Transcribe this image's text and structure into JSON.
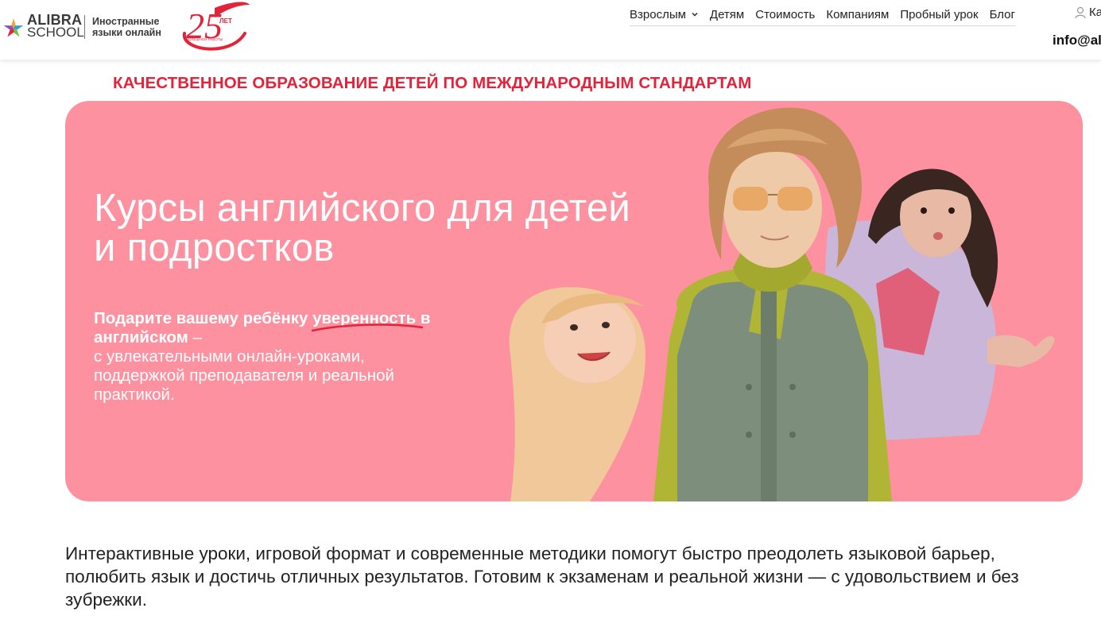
{
  "header": {
    "logo": {
      "name": "ALIBRA",
      "school": "SCHOOL"
    },
    "tagline": "Иностранные языки онлайн",
    "anniversary": {
      "number": "25",
      "label": "ЛЕТ",
      "caption": "УСПЕШНОЙ РАБОТЫ"
    },
    "nav": [
      {
        "label": "Взрослым",
        "has_dropdown": true
      },
      {
        "label": "Детям"
      },
      {
        "label": "Стоимость"
      },
      {
        "label": "Компаниям"
      },
      {
        "label": "Пробный урок"
      },
      {
        "label": "Блог"
      }
    ],
    "account_label": "Ка",
    "email": "info@al"
  },
  "eyebrow": "КАЧЕСТВЕННОЕ ОБРАЗОВАНИЕ ДЕТЕЙ ПО МЕЖДУНАРОДНЫМ СТАНДАРТАМ",
  "hero": {
    "title": "Курсы английского для детей и подростков",
    "lead_part1": "Подарите вашему ребёнку ",
    "lead_highlight": "уверенность",
    "lead_part2": " в английском",
    "dash": " –",
    "rest": "с увлекательными онлайн-уроками, поддержкой преподавателя и реальной практикой.",
    "background_color": "#fe919f"
  },
  "intro": "Интерактивные уроки, игровой формат и современные методики помогут быстро преодолеть языковой барьер, полюбить язык и достичь отличных результатов. Готовим к экзаменам и реальной жизни — с удовольствием и без зубрежки.",
  "colors": {
    "accent_red": "#e2233a",
    "hero_pink": "#fe919f"
  }
}
